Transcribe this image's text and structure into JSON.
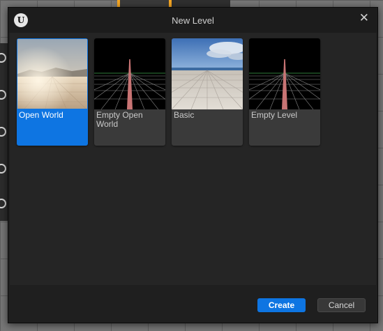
{
  "dialog": {
    "title": "New Level",
    "logo_icon": "unreal-logo-icon",
    "close_icon": "close-icon",
    "close_glyph": "✕"
  },
  "templates": [
    {
      "label": "Open World",
      "selected": true,
      "thumbnail": "desert-landscape"
    },
    {
      "label": "Empty Open World",
      "selected": false,
      "thumbnail": "grid-horizon"
    },
    {
      "label": "Basic",
      "selected": false,
      "thumbnail": "sky-tile-floor"
    },
    {
      "label": "Empty Level",
      "selected": false,
      "thumbnail": "grid-horizon"
    }
  ],
  "footer": {
    "create_label": "Create",
    "cancel_label": "Cancel"
  },
  "colors": {
    "accent": "#0e75e2",
    "dialog_bg": "#1f1f1f",
    "tile_bg": "#3a3a3a"
  }
}
